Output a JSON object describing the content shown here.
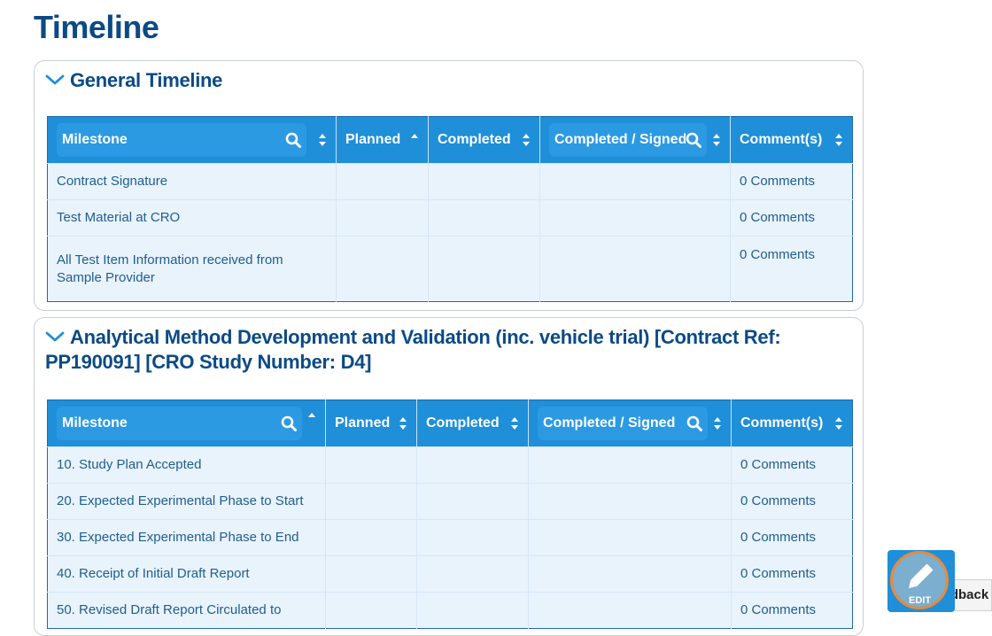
{
  "page": {
    "title": "Timeline"
  },
  "sections": [
    {
      "title": "General Timeline",
      "columns": [
        "Milestone",
        "Planned",
        "Completed",
        "Completed / Signed",
        "Comment(s)"
      ],
      "rows": [
        {
          "milestone": "Contract Signature",
          "comments": "0 Comments"
        },
        {
          "milestone": "Test Material at CRO",
          "comments": "0 Comments"
        },
        {
          "milestone": "All Test Item Information received from Sample Provider",
          "comments": "0 Comments"
        }
      ]
    },
    {
      "title": "Analytical Method Development and Validation (inc. vehicle trial) [Contract Ref: PP190091] [CRO Study Number: D4]",
      "columns": [
        "Milestone",
        "Planned",
        "Completed",
        "Completed / Signed",
        "Comment(s)"
      ],
      "rows": [
        {
          "milestone": "10. Study Plan Accepted",
          "comments": "0 Comments"
        },
        {
          "milestone": "20. Expected Experimental Phase to Start",
          "comments": "0 Comments"
        },
        {
          "milestone": "30. Expected Experimental Phase to End",
          "comments": "0 Comments"
        },
        {
          "milestone": "40. Receipt of Initial Draft Report",
          "comments": "0 Comments"
        },
        {
          "milestone": "50. Revised Draft Report Circulated to",
          "comments": "0 Comments"
        }
      ]
    }
  ],
  "floating": {
    "edit_label": "EDIT",
    "feedback_label": "Feedback"
  },
  "colors": {
    "header_bg": "#1e8fd8",
    "row_bg": "#e9f3fc",
    "title": "#0b4a85",
    "edit_ring": "#e8893b"
  }
}
